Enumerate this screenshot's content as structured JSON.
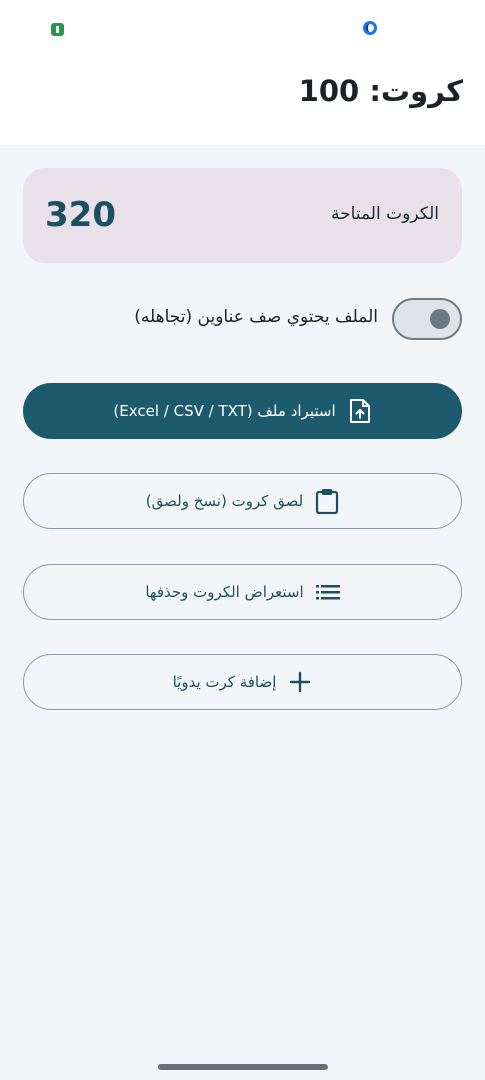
{
  "header": {
    "title": "كروت: 100"
  },
  "available": {
    "label": "الكروت المتاحة",
    "value": "320"
  },
  "toggle": {
    "label": "الملف يحتوي صف عناوين (تجاهله)",
    "state": "on"
  },
  "buttons": {
    "import_label": "استيراد ملف (Excel / CSV / TXT)",
    "paste_label": "لصق كروت (نسخ ولصق)",
    "view_label": "استعراض الكروت وحذفها",
    "add_label": "إضافة كرت يدويًا"
  },
  "icons": {
    "import": "file-upload-icon",
    "paste": "clipboard-icon",
    "view": "list-icon",
    "add": "plus-icon"
  },
  "colors": {
    "primary": "#1e5a6e",
    "card_bg": "#e9e1ea",
    "background": "#f3f6f8",
    "outline": "#8e97a3"
  }
}
